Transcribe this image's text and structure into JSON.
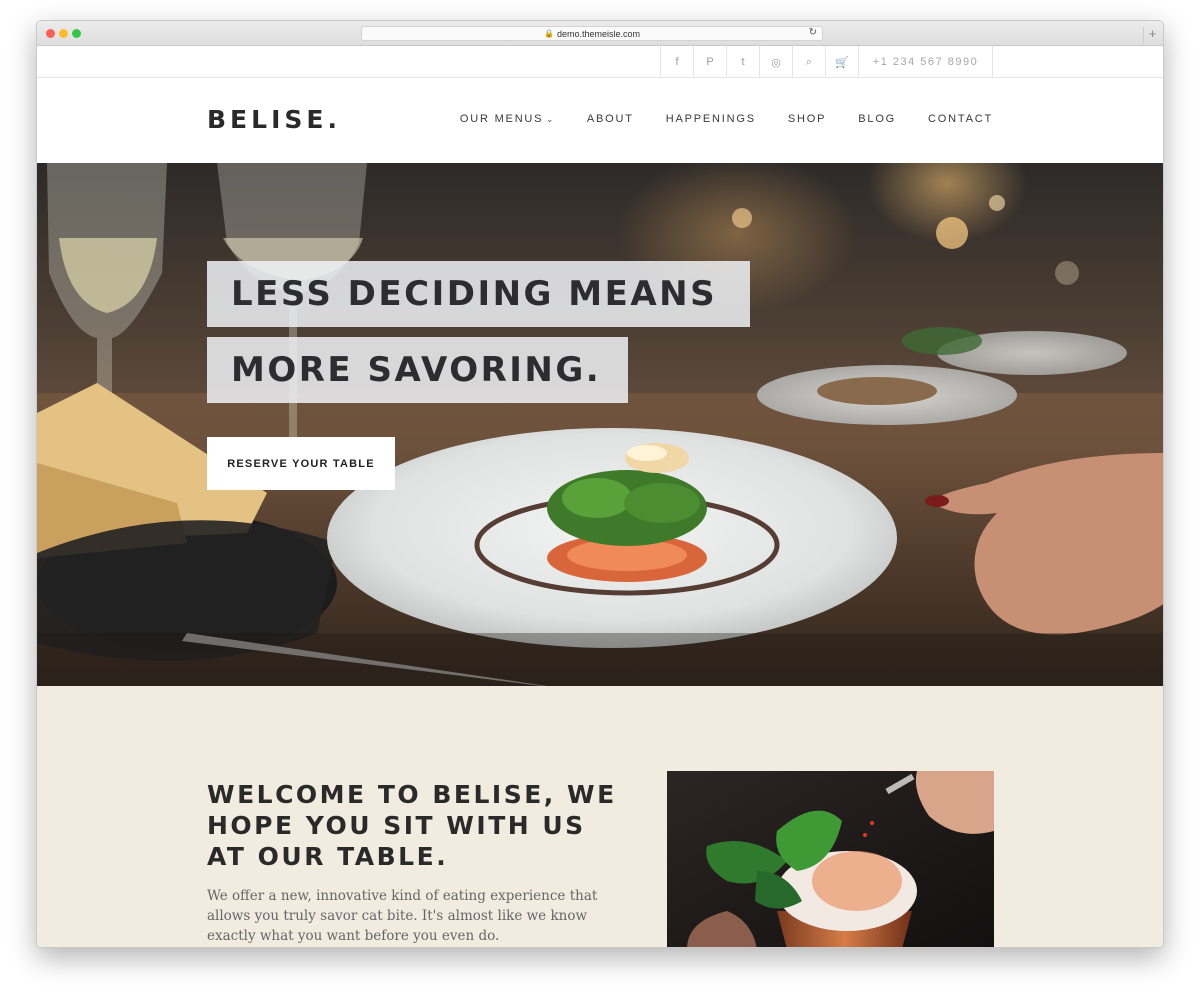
{
  "browser": {
    "url": "demo.themeisle.com",
    "new_tab": "+"
  },
  "topbar": {
    "social": [
      {
        "name": "facebook-icon",
        "glyph": "f"
      },
      {
        "name": "pinterest-icon",
        "glyph": "P"
      },
      {
        "name": "twitter-icon",
        "glyph": "t"
      },
      {
        "name": "instagram-icon",
        "glyph": "◎"
      },
      {
        "name": "search-icon",
        "glyph": "⌕"
      },
      {
        "name": "cart-icon",
        "glyph": "🛒"
      }
    ],
    "phone": "+1 234 567 8990"
  },
  "header": {
    "logo": "BELISE.",
    "nav": {
      "menus": "OUR MENUS",
      "about": "ABOUT",
      "happenings": "HAPPENINGS",
      "shop": "SHOP",
      "blog": "BLOG",
      "contact": "CONTACT"
    }
  },
  "hero": {
    "headline_line1": "LESS DECIDING MEANS",
    "headline_line2": "MORE SAVORING.",
    "cta": "RESERVE YOUR TABLE"
  },
  "welcome": {
    "title": "WELCOME TO BELISE, WE HOPE YOU SIT WITH US AT OUR TABLE.",
    "body": "We offer a new, innovative kind of eating experience that allows you truly savor cat bite. It's almost like we know exactly what you want before you even do."
  },
  "colors": {
    "beige": "#f2ebe0",
    "dark_text": "#2a2a2a"
  }
}
